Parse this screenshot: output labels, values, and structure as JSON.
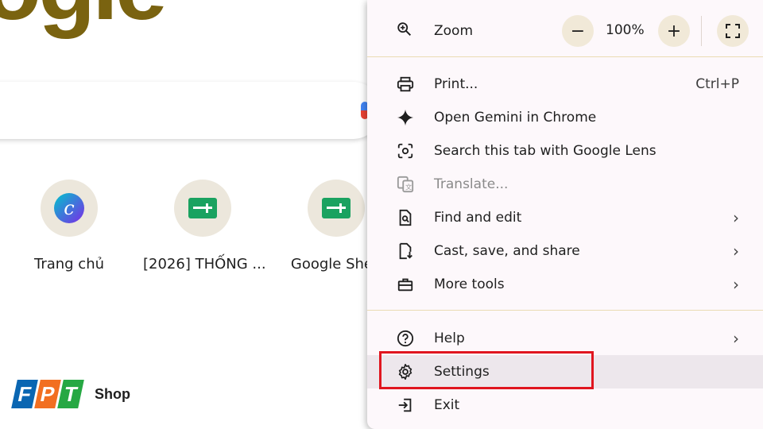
{
  "background": {
    "logo_fragment": "ogle",
    "shortcuts": [
      {
        "label": "Trang chủ",
        "icon": "canva-icon"
      },
      {
        "label": "[2026] THỐNG ...",
        "icon": "google-sheets-icon"
      },
      {
        "label": "Google Shee",
        "icon": "google-sheets-icon"
      }
    ],
    "fpt_logo": {
      "letters": [
        "F",
        "P",
        "T"
      ],
      "shop": "Shop",
      "colors": [
        "#0a66b2",
        "#f26f21",
        "#26a843"
      ]
    }
  },
  "menu": {
    "zoom": {
      "label": "Zoom",
      "level": "100%",
      "minus": "−",
      "plus": "+"
    },
    "items": [
      {
        "label": "Print...",
        "shortcut": "Ctrl+P",
        "icon": "printer-icon"
      },
      {
        "label": "Open Gemini in Chrome",
        "icon": "gemini-sparkle-icon"
      },
      {
        "label": "Search this tab with Google Lens",
        "icon": "google-lens-icon"
      },
      {
        "label": "Translate...",
        "icon": "translate-icon",
        "disabled": true
      },
      {
        "label": "Find and edit",
        "icon": "find-page-icon",
        "submenu": "›"
      },
      {
        "label": "Cast, save, and share",
        "icon": "file-save-icon",
        "submenu": "›"
      },
      {
        "label": "More tools",
        "icon": "toolbox-icon",
        "submenu": "›"
      }
    ],
    "help": {
      "label": "Help",
      "submenu": "›"
    },
    "settings": {
      "label": "Settings"
    },
    "exit": {
      "label": "Exit"
    }
  },
  "colors": {
    "highlight_border": "#e0161f",
    "menu_bg": "#fdf8fb"
  }
}
